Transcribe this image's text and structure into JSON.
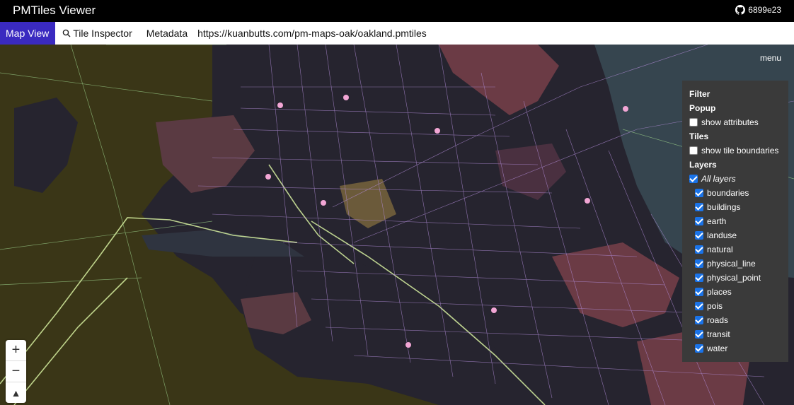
{
  "app": {
    "title": "PMTiles Viewer",
    "commit": "6899e23",
    "github_icon": "github-icon"
  },
  "tabs": [
    {
      "label": "Map View",
      "active": true
    },
    {
      "label": "Tile Inspector",
      "icon": "magnifier-icon"
    },
    {
      "label": "Metadata"
    }
  ],
  "url": "https://kuanbutts.com/pm-maps-oak/oakland.pmtiles",
  "map": {
    "menu_label": "menu",
    "zoom_in": "+",
    "zoom_out": "−",
    "compass": "▲",
    "colors": {
      "earth": "#3a3617",
      "land": "#26242f",
      "landuse": "#6b3b45",
      "water": "#36454f",
      "roads": "#b18cd8",
      "highway": "#d7f0a0",
      "places": "#f2a6d5"
    }
  },
  "panel": {
    "filter_header": "Filter",
    "popup_header": "Popup",
    "show_attributes": {
      "label": "show attributes",
      "checked": false
    },
    "tiles_header": "Tiles",
    "show_tile_boundaries": {
      "label": "show tile boundaries",
      "checked": false
    },
    "layers_header": "Layers",
    "all_layers": {
      "label": "All layers",
      "checked": true
    },
    "layers": [
      {
        "label": "boundaries",
        "checked": true
      },
      {
        "label": "buildings",
        "checked": true
      },
      {
        "label": "earth",
        "checked": true
      },
      {
        "label": "landuse",
        "checked": true
      },
      {
        "label": "natural",
        "checked": true
      },
      {
        "label": "physical_line",
        "checked": true
      },
      {
        "label": "physical_point",
        "checked": true
      },
      {
        "label": "places",
        "checked": true
      },
      {
        "label": "pois",
        "checked": true
      },
      {
        "label": "roads",
        "checked": true
      },
      {
        "label": "transit",
        "checked": true
      },
      {
        "label": "water",
        "checked": true
      }
    ]
  }
}
